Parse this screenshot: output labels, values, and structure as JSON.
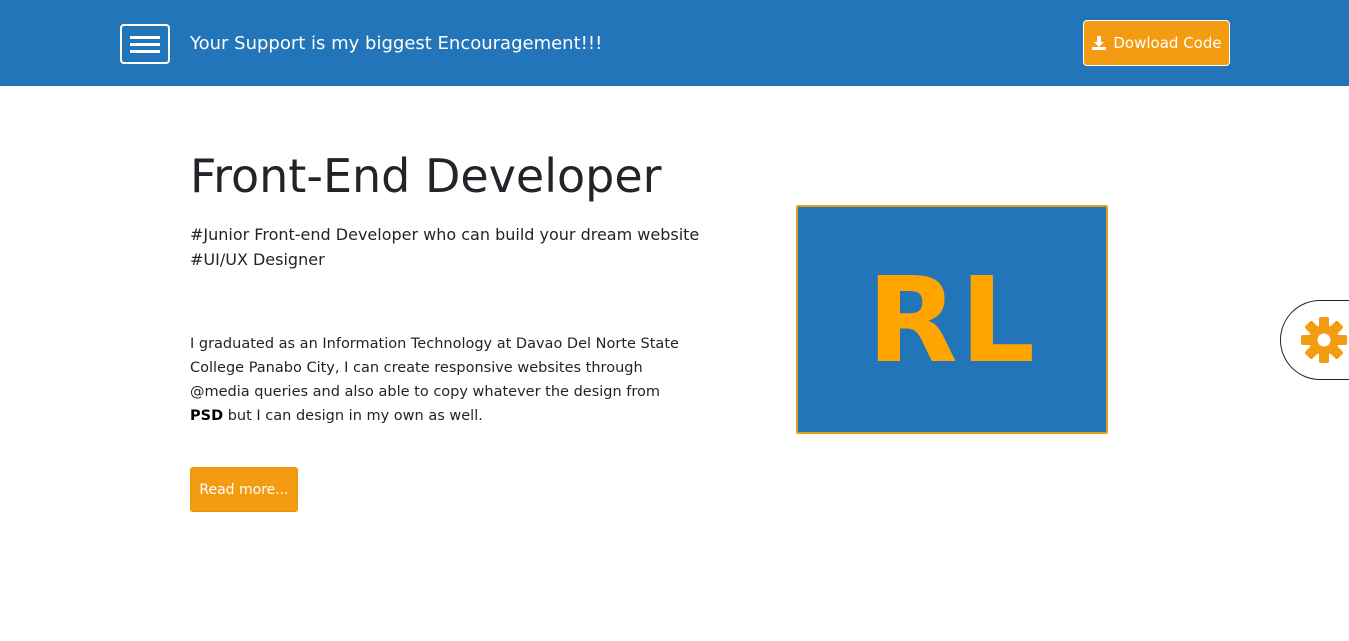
{
  "header": {
    "menu_icon": "hamburger-icon",
    "support_text": "Your Support is my biggest Encouragement!!!",
    "download": {
      "icon": "download-icon",
      "label": "Dowload Code"
    }
  },
  "hero": {
    "title": "Front-End Developer",
    "tagline_lines": [
      "#Junior Front-end Developer who can build your dream website",
      "#UI/UX Designer"
    ],
    "about_text": "I graduated as an Information Technology at Davao Del Norte State College Panabo City, I can create responsive websites through @media queries and also able to copy whatever the design from",
    "about_bold": "PSD",
    "about_tail": " but I can design in my own as well.",
    "read_more_label": "Read more..."
  },
  "logo": {
    "text": "RL"
  },
  "settings": {
    "icon": "gear-icon"
  },
  "colors": {
    "primary": "#2275b8",
    "accent": "#f39c12",
    "logo_text": "#ffa500"
  }
}
